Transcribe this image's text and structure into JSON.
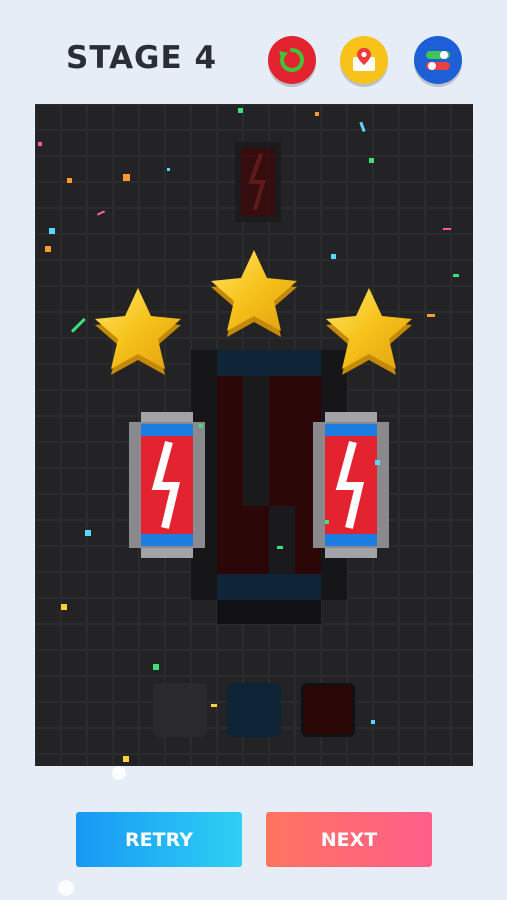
{
  "header": {
    "stage_title": "STAGE 4",
    "icons": [
      "replay-icon",
      "map-pin-icon",
      "settings-toggle-icon"
    ]
  },
  "result": {
    "stars_earned": 3,
    "stars_total": 3
  },
  "puzzle": {
    "item": "battery-pixel-art",
    "palette_colors": [
      "#2a2a2c",
      "#0f2436",
      "#2b0707"
    ],
    "selected_palette_index": 2
  },
  "buttons": {
    "retry_label": "RETRY",
    "next_label": "NEXT"
  },
  "colors": {
    "background": "#e6edf6",
    "board": "#232325",
    "retry_gradient": [
      "#1798f5",
      "#2ed0f3"
    ],
    "next_gradient": [
      "#ff7460",
      "#ff5e8a"
    ],
    "star": "#f7c21a",
    "battery_red": "#e3232f",
    "battery_blue": "#1d7de0"
  }
}
